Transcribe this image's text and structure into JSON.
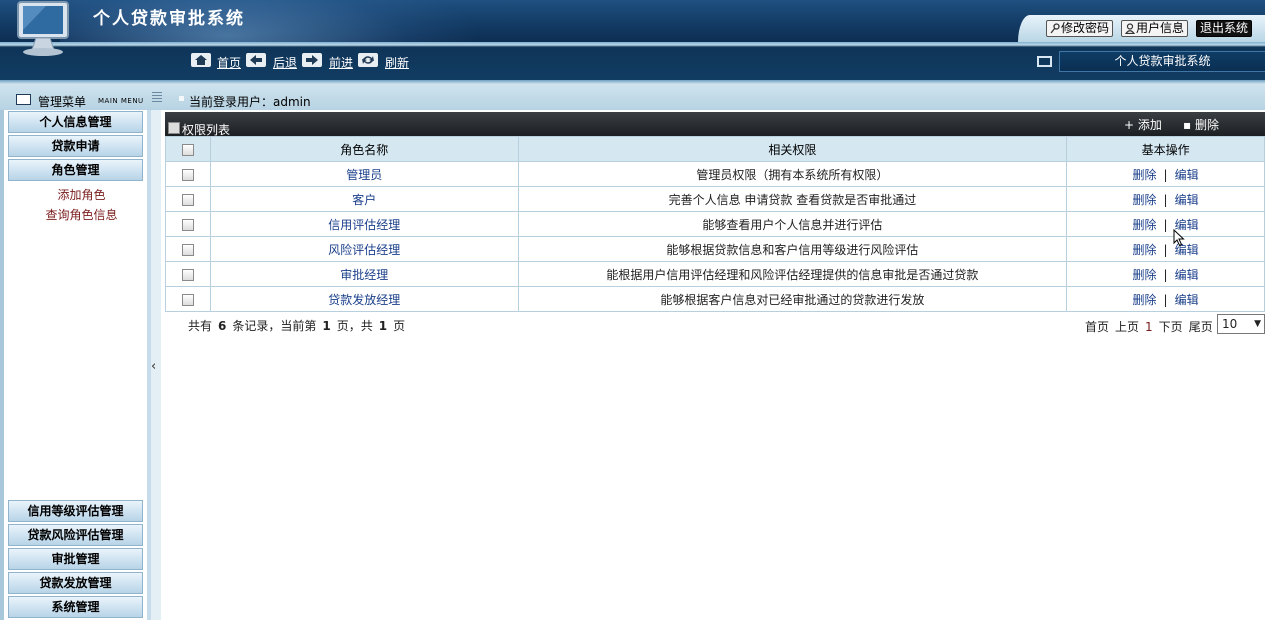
{
  "header": {
    "title": "个人贷款审批系统",
    "buttons": {
      "change_password": "修改密码",
      "user_info": "用户信息",
      "logout": "退出系统"
    }
  },
  "nav": {
    "home": "首页",
    "back": "后退",
    "forward": "前进",
    "refresh": "刷新",
    "system_name": "个人贷款审批系统"
  },
  "menu_bar": {
    "title": "管理菜单",
    "title_en": "MAIN MENU",
    "current_user_label": "当前登录用户：admin"
  },
  "sidebar": {
    "top_items": [
      "个人信息管理",
      "贷款申请",
      "角色管理"
    ],
    "sub_items": [
      "添加角色",
      "查询角色信息"
    ],
    "bottom_items": [
      "信用等级评估管理",
      "贷款风险评估管理",
      "审批管理",
      "贷款发放管理",
      "系统管理"
    ]
  },
  "list": {
    "title": "权限列表",
    "add": "添加",
    "delete": "删除",
    "columns": [
      "角色名称",
      "相关权限",
      "基本操作"
    ],
    "rows": [
      {
        "role": "管理员",
        "perm": "管理员权限（拥有本系统所有权限）"
      },
      {
        "role": "客户",
        "perm": "完善个人信息 申请贷款 查看贷款是否审批通过"
      },
      {
        "role": "信用评估经理",
        "perm": "能够查看用户个人信息并进行评估"
      },
      {
        "role": "风险评估经理",
        "perm": "能够根据贷款信息和客户信用等级进行风险评估"
      },
      {
        "role": "审批经理",
        "perm": "能根据用户信用评估经理和风险评估经理提供的信息审批是否通过贷款"
      },
      {
        "role": "贷款发放经理",
        "perm": "能够根据客户信息对已经审批通过的贷款进行发放"
      }
    ],
    "row_ops": {
      "delete": "删除",
      "sep": "|",
      "edit": "编辑"
    }
  },
  "pager": {
    "total_prefix": "共有",
    "total": "6",
    "total_mid": "条记录，当前第",
    "current": "1",
    "current_mid": "页，共",
    "pages": "1",
    "pages_suffix": "页",
    "first": "首页",
    "prev": "上页",
    "page_num": "1",
    "next": "下页",
    "last": "尾页",
    "page_size": "10"
  }
}
